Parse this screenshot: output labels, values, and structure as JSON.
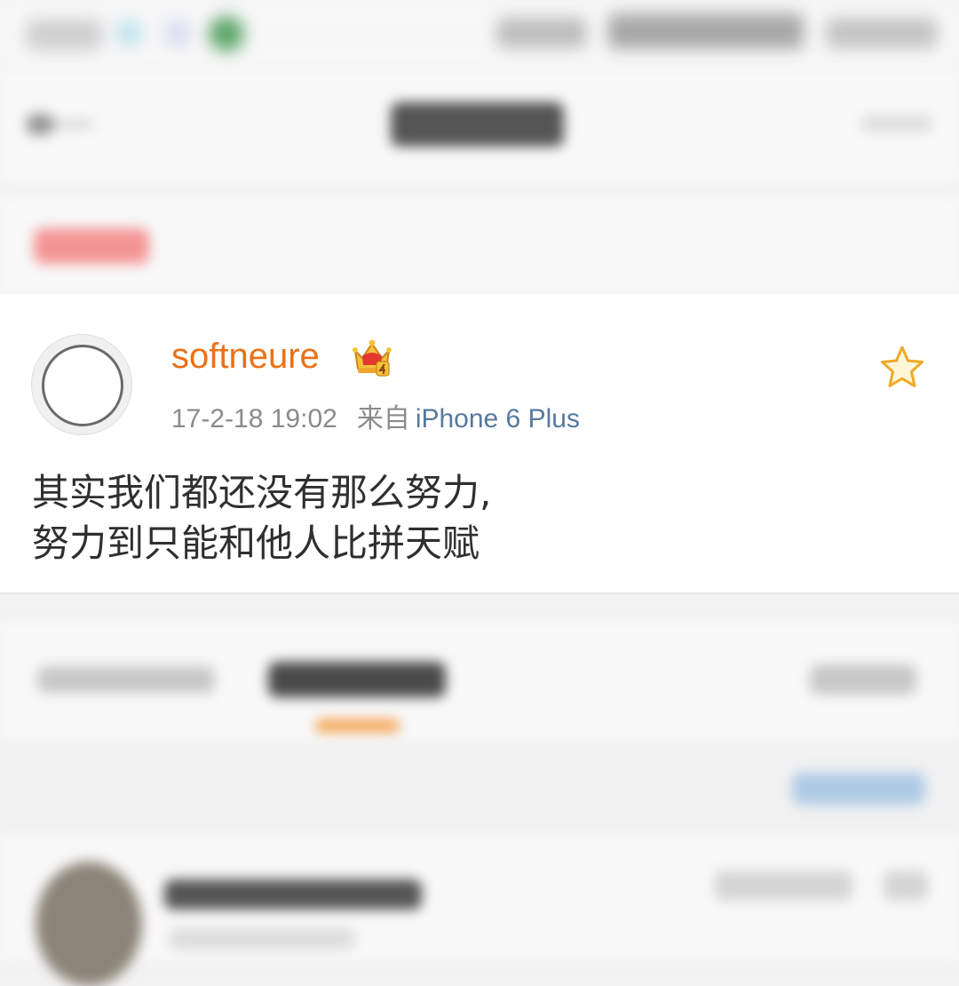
{
  "post": {
    "username": "softneure",
    "timestamp": "17-2-18 19:02",
    "source_prefix": "来自",
    "source_device": "iPhone 6 Plus",
    "text_line1": "其实我们都还没有那么努力,",
    "text_line2": "努力到只能和他人比拼天赋",
    "username_color": "#eb7117",
    "device_color": "#57799d"
  },
  "icons": {
    "crown": "crown-badge-icon",
    "favorite": "star-icon",
    "back": "back-arrow-icon"
  }
}
